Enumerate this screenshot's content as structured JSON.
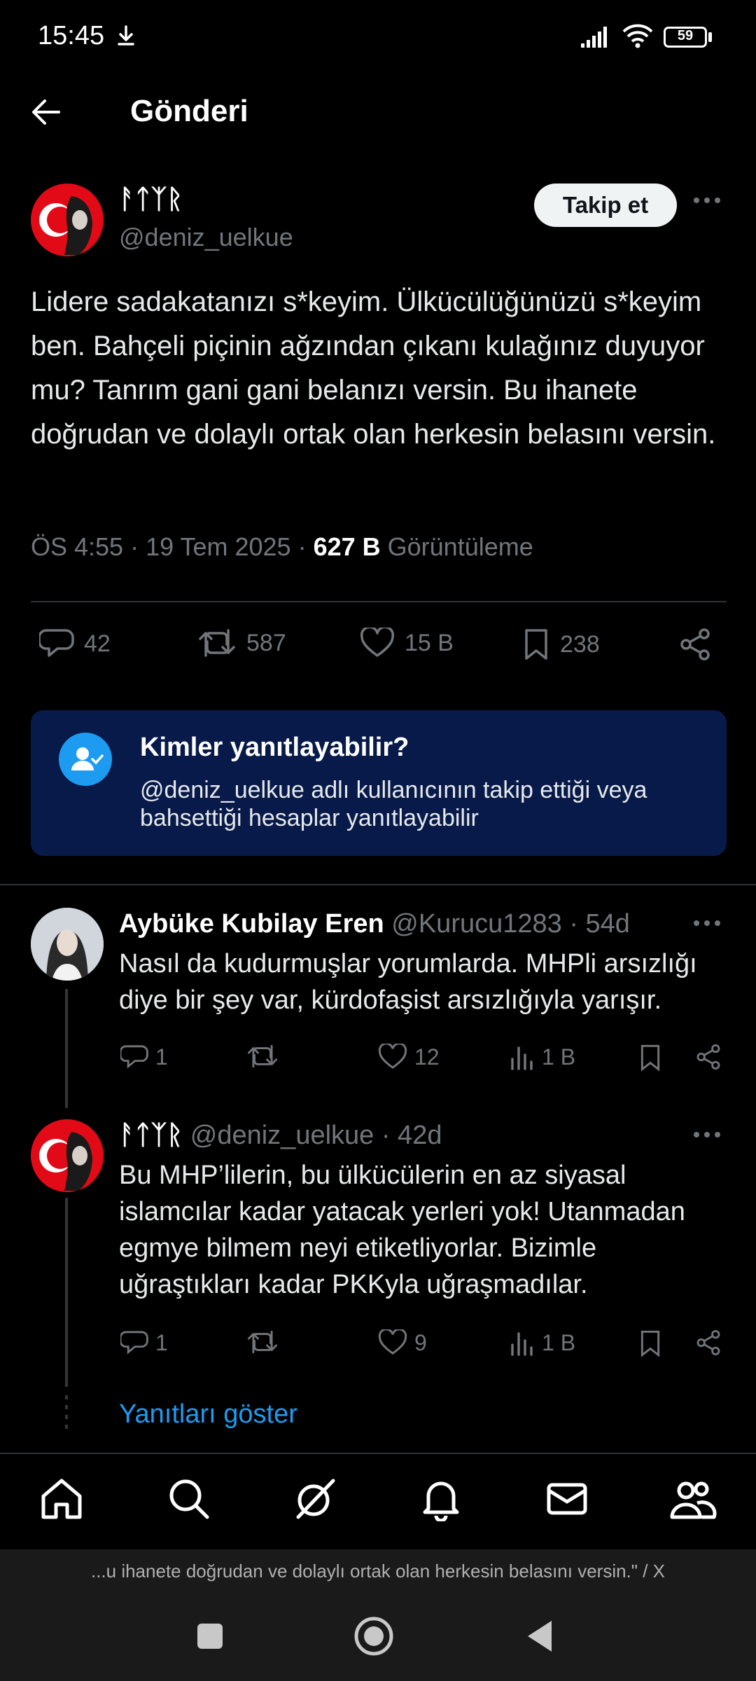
{
  "status_bar": {
    "time": "15:45",
    "battery": "59"
  },
  "header": {
    "title": "Gönderi"
  },
  "post": {
    "author_name": "ᚨᛏᛉᚱ",
    "author_handle": "@deniz_uelkue",
    "follow_label": "Takip et",
    "text": "Lidere sadakatanızı s*keyim. Ülkücülüğünüzü s*keyim ben. Bahçeli piçinin ağzından çıkanı kulağınız duyuyor mu? Tanrım gani gani belanızı versin. Bu ihanete doğrudan ve dolaylı ortak olan herkesin belasını versin.",
    "time": "ÖS 4:55 · 19 Tem 2025 · ",
    "views_count": "627 B",
    "views_label": " Görüntüleme",
    "replies": "42",
    "retweets": "587",
    "likes": "15 B",
    "bookmarks": "238"
  },
  "reply_info": {
    "title": "Kimler yanıtlayabilir?",
    "description": "@deniz_uelkue adlı kullanıcının takip ettiği veya bahsettiği hesaplar yanıtlayabilir"
  },
  "replies": [
    {
      "name": "Aybüke Kubilay Eren",
      "handle_time": " @Kurucu1283 · 54d",
      "text": "Nasıl da kudurmuşlar yorumlarda. MHPli arsızlığı diye bir şey var, kürdofaşist arsızlığıyla yarışır.",
      "reply_count": "1",
      "retweet_count": "",
      "like_count": "12",
      "view_count": "1 B"
    },
    {
      "name": "ᚨᛏᛉᚱ",
      "handle_time": " @deniz_uelkue · 42d",
      "text": "Bu MHP’lilerin, bu ülkücülerin en az siyasal islamcılar kadar yatacak yerleri yok! Utanmadan egmye bilmem neyi etiketliyorlar. Bizimle uğraştıkları kadar PKKyla uğraşmadılar.",
      "reply_count": "1",
      "retweet_count": "",
      "like_count": "9",
      "view_count": "1 B"
    }
  ],
  "show_replies": "Yanıtları göster",
  "url_bar": "...u ihanete doğrudan ve dolaylı ortak olan herkesin belasını versin.\" / X",
  "colors": {
    "accent": "#1d9bf0",
    "reply_box": "#071a4a",
    "muted": "#71767b"
  }
}
